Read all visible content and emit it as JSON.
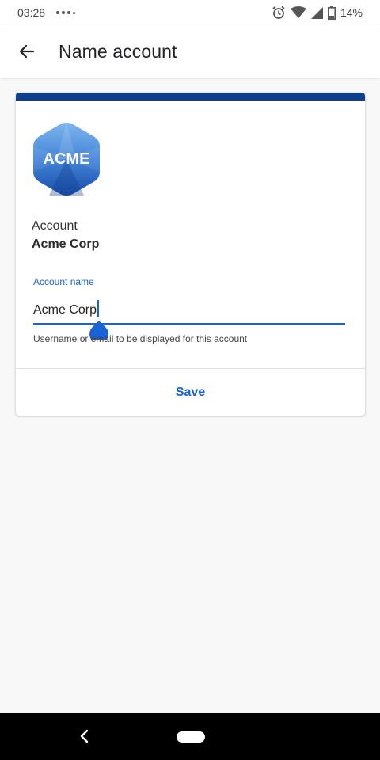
{
  "status_bar": {
    "time": "03:28",
    "battery": "14%",
    "icons": [
      "notification-dots-icon",
      "alarm-icon",
      "wifi-icon",
      "signal-icon",
      "battery-icon"
    ]
  },
  "app_bar": {
    "title": "Name account",
    "back_icon": "arrow-back-icon"
  },
  "card": {
    "accent_color": "#0d3f8c",
    "logo_text": "ACME",
    "account_label": "Account",
    "account_value": "Acme Corp",
    "field": {
      "label": "Account name",
      "value": "Acme Corp",
      "helper": "Username or email to be displayed for this account"
    },
    "save_label": "Save"
  },
  "colors": {
    "primary": "#1a63d6",
    "background": "#f8f8f8"
  }
}
